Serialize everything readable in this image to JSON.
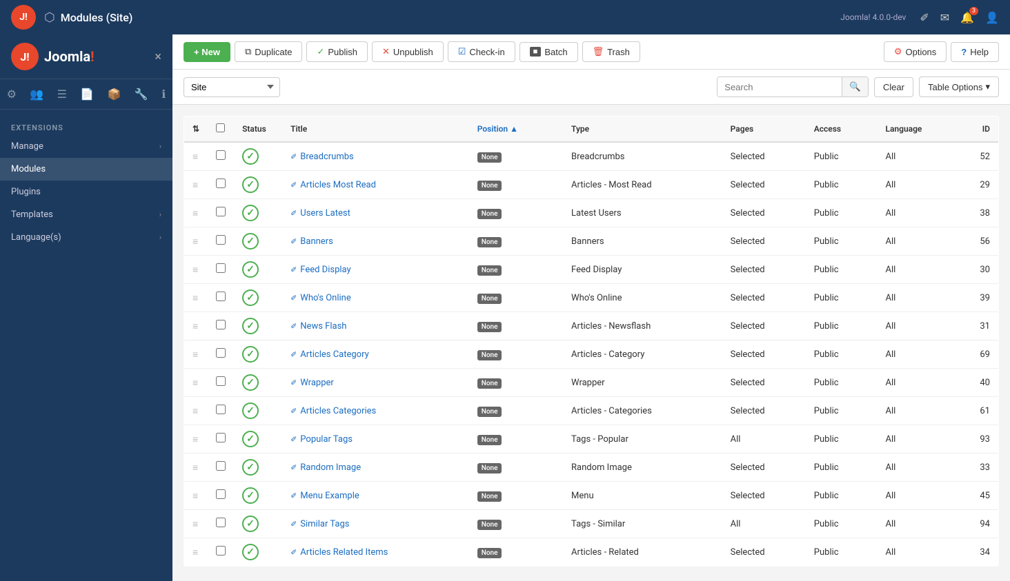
{
  "topbar": {
    "version": "Joomla! 4.0.0-dev",
    "title": "Modules (Site)",
    "notification_count": "3"
  },
  "sidebar": {
    "section_label": "EXTENSIONS",
    "close_label": "×",
    "items": [
      {
        "id": "manage",
        "label": "Manage",
        "has_arrow": true
      },
      {
        "id": "modules",
        "label": "Modules",
        "has_arrow": false,
        "active": true
      },
      {
        "id": "plugins",
        "label": "Plugins",
        "has_arrow": false
      },
      {
        "id": "templates",
        "label": "Templates",
        "has_arrow": true
      },
      {
        "id": "languages",
        "label": "Language(s)",
        "has_arrow": true
      }
    ]
  },
  "toolbar": {
    "new_label": "+ New",
    "duplicate_label": "Duplicate",
    "publish_label": "Publish",
    "unpublish_label": "Unpublish",
    "checkin_label": "Check-in",
    "batch_label": "Batch",
    "trash_label": "Trash",
    "options_label": "Options",
    "help_label": "Help"
  },
  "filter": {
    "site_option": "Site",
    "search_placeholder": "Search",
    "clear_label": "Clear",
    "table_options_label": "Table Options"
  },
  "table": {
    "headers": {
      "drag": "",
      "check": "",
      "status": "Status",
      "title": "Title",
      "position": "Position",
      "type": "Type",
      "pages": "Pages",
      "access": "Access",
      "language": "Language",
      "id": "ID"
    },
    "rows": [
      {
        "id": 52,
        "status": "published",
        "title": "Breadcrumbs",
        "position": "None",
        "type": "Breadcrumbs",
        "pages": "Selected",
        "access": "Public",
        "language": "All"
      },
      {
        "id": 29,
        "status": "published",
        "title": "Articles Most Read",
        "position": "None",
        "type": "Articles - Most Read",
        "pages": "Selected",
        "access": "Public",
        "language": "All"
      },
      {
        "id": 38,
        "status": "published",
        "title": "Users Latest",
        "position": "None",
        "type": "Latest Users",
        "pages": "Selected",
        "access": "Public",
        "language": "All"
      },
      {
        "id": 56,
        "status": "published",
        "title": "Banners",
        "position": "None",
        "type": "Banners",
        "pages": "Selected",
        "access": "Public",
        "language": "All"
      },
      {
        "id": 30,
        "status": "published",
        "title": "Feed Display",
        "position": "None",
        "type": "Feed Display",
        "pages": "Selected",
        "access": "Public",
        "language": "All"
      },
      {
        "id": 39,
        "status": "published",
        "title": "Who's Online",
        "position": "None",
        "type": "Who's Online",
        "pages": "Selected",
        "access": "Public",
        "language": "All"
      },
      {
        "id": 31,
        "status": "published",
        "title": "News Flash",
        "position": "None",
        "type": "Articles - Newsflash",
        "pages": "Selected",
        "access": "Public",
        "language": "All"
      },
      {
        "id": 69,
        "status": "published",
        "title": "Articles Category",
        "position": "None",
        "type": "Articles - Category",
        "pages": "Selected",
        "access": "Public",
        "language": "All"
      },
      {
        "id": 40,
        "status": "published",
        "title": "Wrapper",
        "position": "None",
        "type": "Wrapper",
        "pages": "Selected",
        "access": "Public",
        "language": "All"
      },
      {
        "id": 61,
        "status": "published",
        "title": "Articles Categories",
        "position": "None",
        "type": "Articles - Categories",
        "pages": "Selected",
        "access": "Public",
        "language": "All"
      },
      {
        "id": 93,
        "status": "published",
        "title": "Popular Tags",
        "position": "None",
        "type": "Tags - Popular",
        "pages": "All",
        "access": "Public",
        "language": "All"
      },
      {
        "id": 33,
        "status": "published",
        "title": "Random Image",
        "position": "None",
        "type": "Random Image",
        "pages": "Selected",
        "access": "Public",
        "language": "All"
      },
      {
        "id": 45,
        "status": "published",
        "title": "Menu Example",
        "position": "None",
        "type": "Menu",
        "pages": "Selected",
        "access": "Public",
        "language": "All"
      },
      {
        "id": 94,
        "status": "published",
        "title": "Similar Tags",
        "position": "None",
        "type": "Tags - Similar",
        "pages": "All",
        "access": "Public",
        "language": "All"
      },
      {
        "id": 34,
        "status": "published",
        "title": "Articles Related Items",
        "position": "None",
        "type": "Articles - Related",
        "pages": "Selected",
        "access": "Public",
        "language": "All"
      }
    ]
  },
  "icons": {
    "drag": "≡",
    "edit": "✎",
    "check_published": "✓",
    "search": "🔍",
    "chevron_down": "▾",
    "arrow_up": "▲",
    "gear": "⚙",
    "question": "?",
    "bell": "🔔",
    "mail": "✉",
    "user": "👤",
    "pencil_square": "✐",
    "back": "‹"
  },
  "colors": {
    "accent_blue": "#1b6dc1",
    "sidebar_bg": "#1c3a5e",
    "published_green": "#4caf50",
    "new_green": "#4caf50",
    "none_badge": "#666666"
  }
}
